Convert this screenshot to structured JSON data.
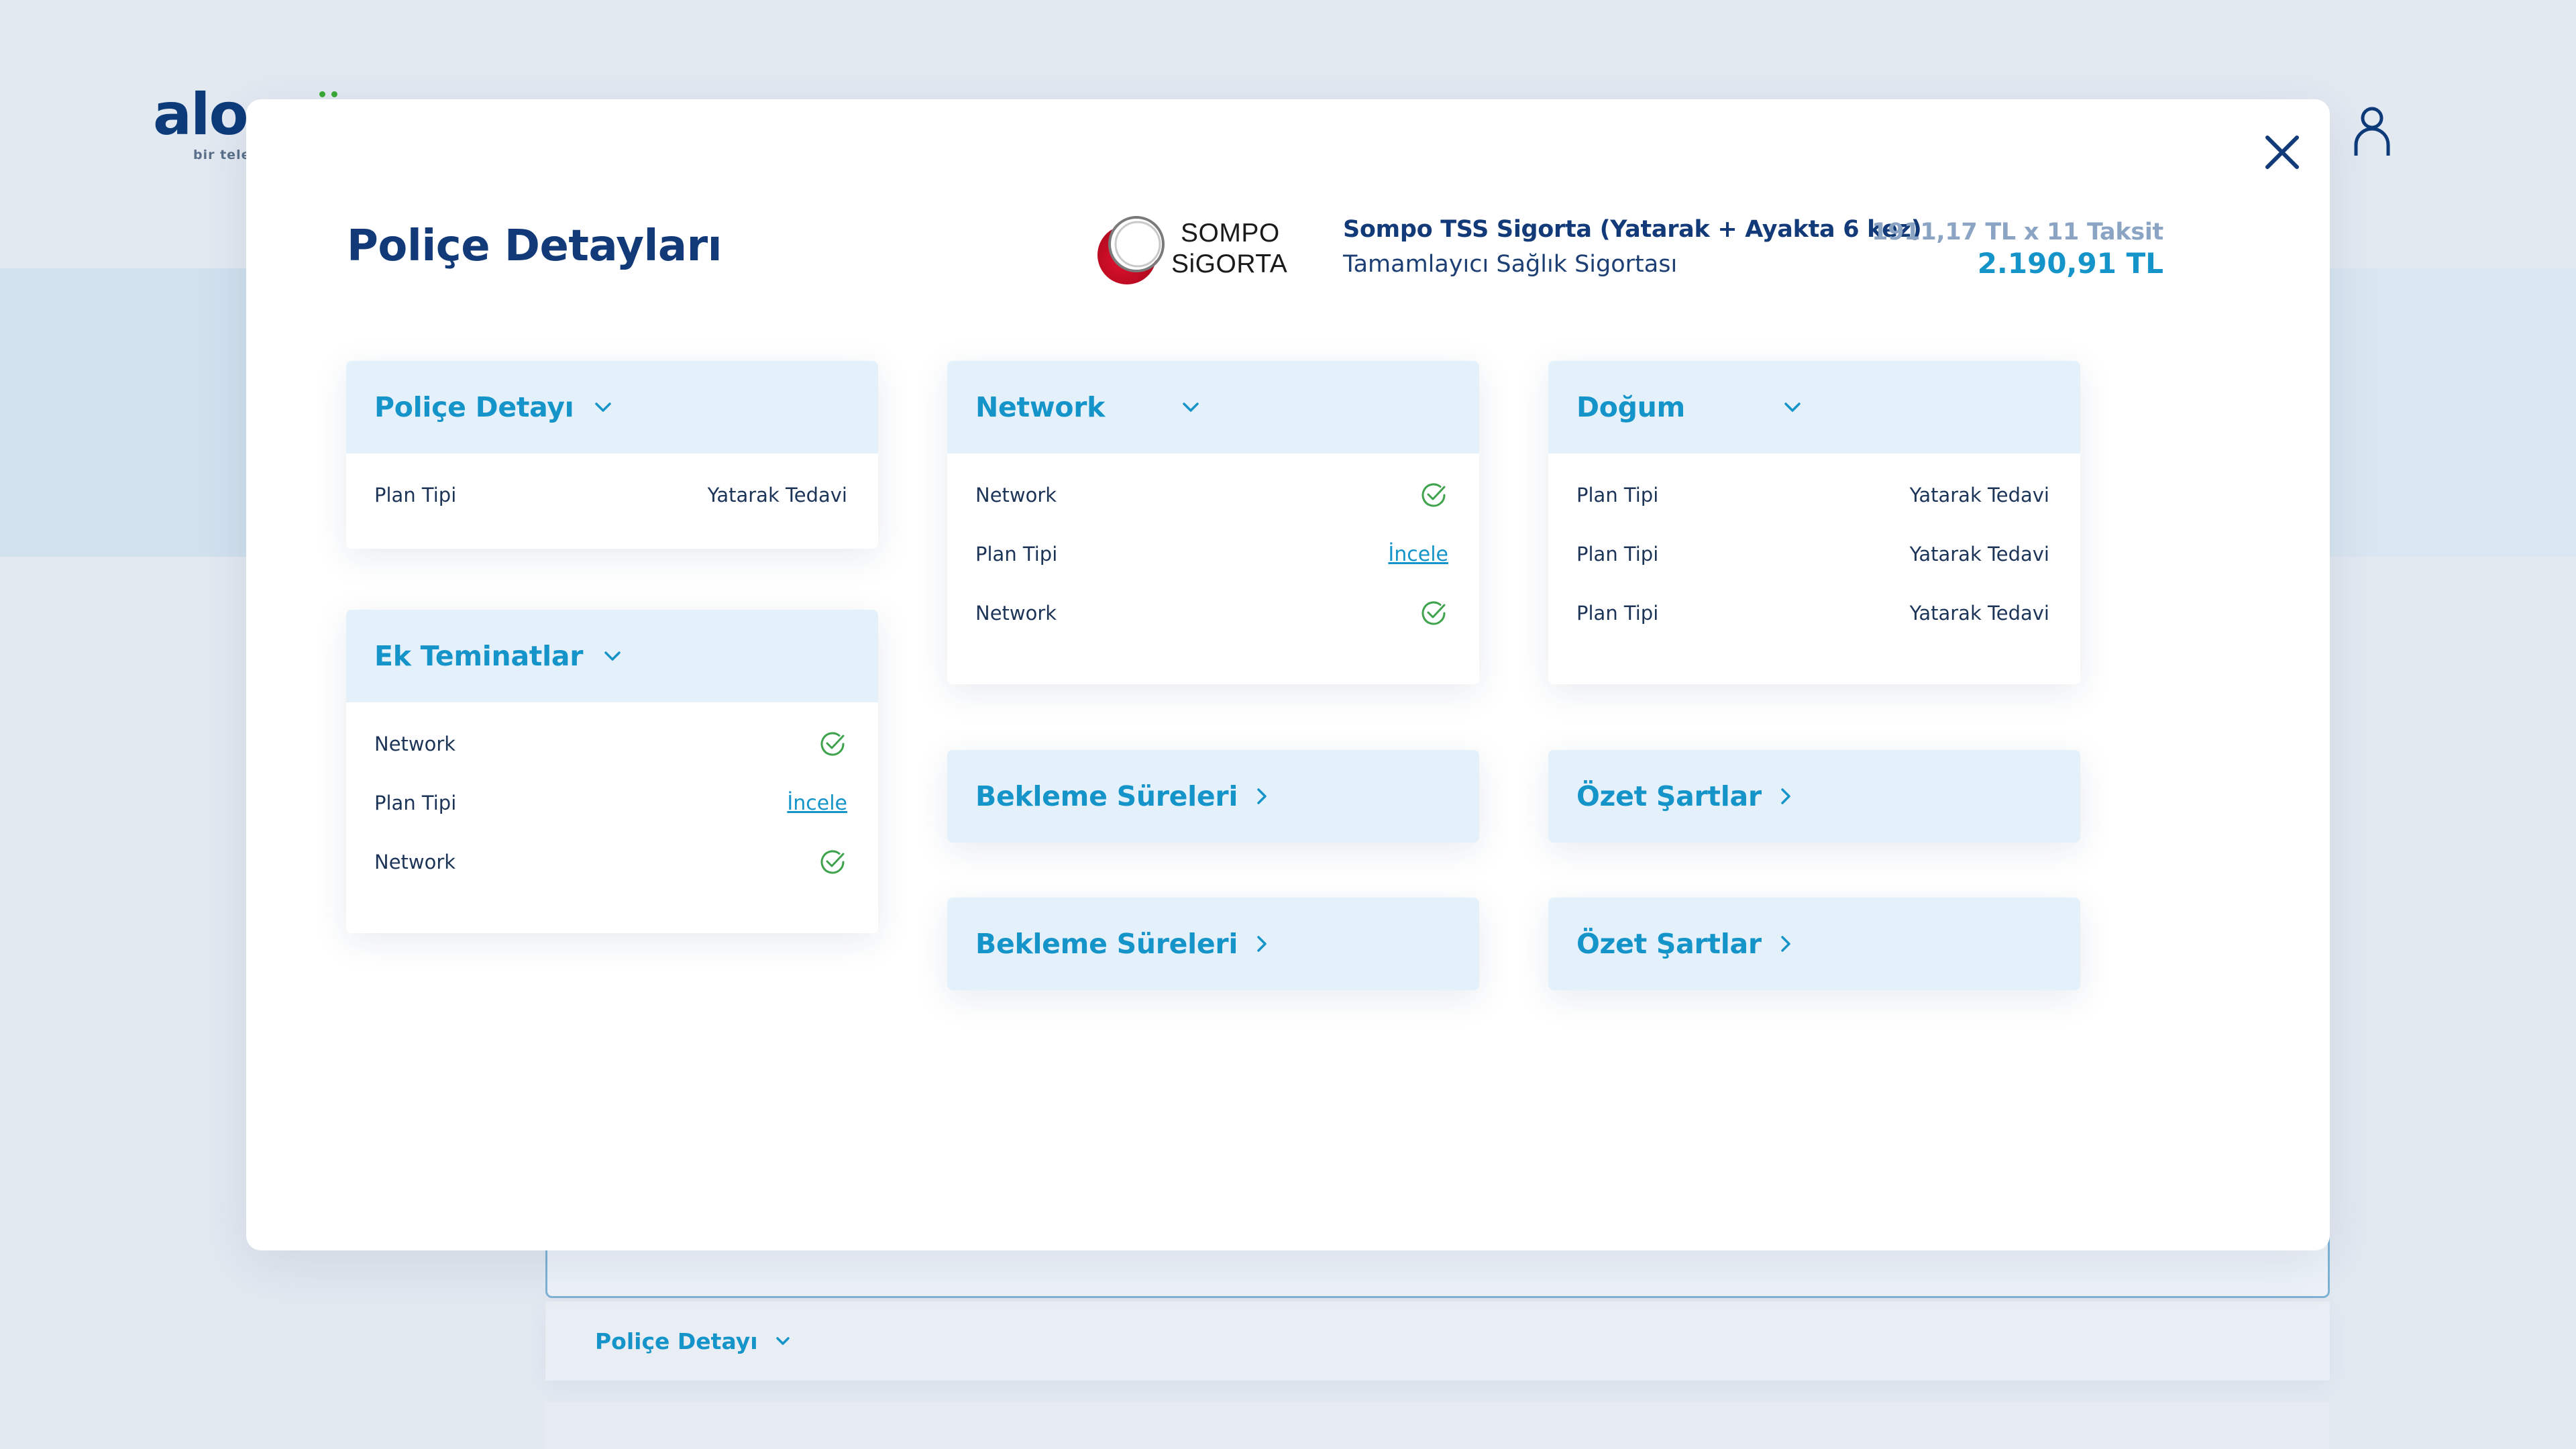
{
  "background": {
    "logo_text": "alo",
    "logo_tagline": "bir teleteko",
    "bg_accordion_label": "Poliçe Detayı"
  },
  "modal": {
    "title": "Poliçe Detayları",
    "insurer": {
      "logo_line1": "SOMPO",
      "logo_line2": "SiGORTA"
    },
    "product": {
      "name": "Sompo TSS Sigorta (Yatarak + Ayakta 6 kez)",
      "type": "Tamamlayıcı Sağlık Sigortası"
    },
    "price": {
      "installment": "1911,17 TL x 11 Taksit",
      "total": "2.190,91 TL"
    },
    "sections": {
      "police_detayi": {
        "label": "Poliçe Detayı",
        "rows": [
          {
            "key": "Plan Tipi",
            "value": "Yatarak Tedavi"
          }
        ]
      },
      "ek_teminatlar": {
        "label": "Ek Teminatlar",
        "rows": [
          {
            "key": "Network",
            "status": "check"
          },
          {
            "key": "Plan Tipi",
            "link": "İncele"
          },
          {
            "key": "Network",
            "status": "check"
          }
        ]
      },
      "network": {
        "label": "Network",
        "rows": [
          {
            "key": "Network",
            "status": "check"
          },
          {
            "key": "Plan Tipi",
            "link": "İncele"
          },
          {
            "key": "Network",
            "status": "check"
          }
        ]
      },
      "dogum": {
        "label": "Doğum",
        "rows": [
          {
            "key": "Plan Tipi",
            "value": "Yatarak Tedavi"
          },
          {
            "key": "Plan Tipi",
            "value": "Yatarak Tedavi"
          },
          {
            "key": "Plan Tipi",
            "value": "Yatarak Tedavi"
          }
        ]
      },
      "bekleme_1": {
        "label": "Bekleme Süreleri"
      },
      "bekleme_2": {
        "label": "Bekleme Süreleri"
      },
      "ozet_1": {
        "label": "Özet Şartlar"
      },
      "ozet_2": {
        "label": "Özet Şartlar"
      }
    }
  },
  "colors": {
    "brand_dark": "#123a78",
    "accent": "#1594c9",
    "header_fill": "#e4f1fa",
    "check_green": "#3fa34d",
    "overlay_bg": "#e3e9f1"
  }
}
